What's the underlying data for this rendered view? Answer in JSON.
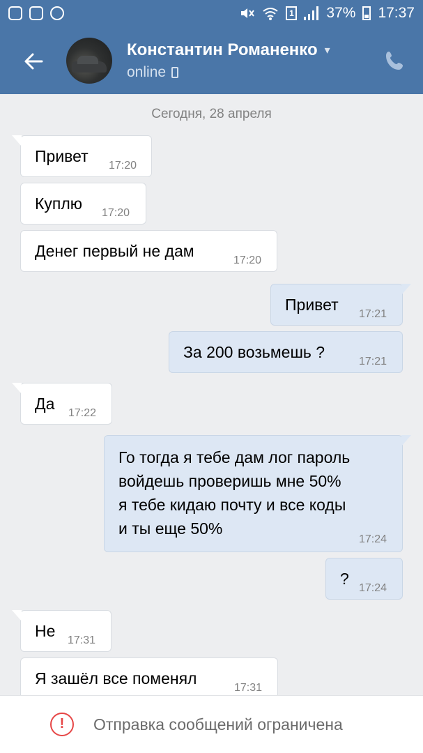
{
  "status_bar": {
    "battery": "37%",
    "time": "17:37",
    "sim": "1"
  },
  "header": {
    "contact_name": "Константин Романенко",
    "status": "online"
  },
  "chat": {
    "date_divider": "Сегодня, 28 апреля",
    "messages": [
      {
        "direction": "in",
        "text": "Привет",
        "time": "17:20"
      },
      {
        "direction": "in",
        "text": "Куплю",
        "time": "17:20"
      },
      {
        "direction": "in",
        "text": "Денег первый не дам",
        "time": "17:20"
      },
      {
        "direction": "out",
        "text": "Привет",
        "time": "17:21"
      },
      {
        "direction": "out",
        "text": "За 200 возьмешь ?",
        "time": "17:21"
      },
      {
        "direction": "in",
        "text": "Да",
        "time": "17:22"
      },
      {
        "direction": "out",
        "lines": [
          "Го тогда я тебе дам лог пароль",
          "войдешь проверишь мне 50%",
          "я тебе кидаю почту и все коды",
          "и ты еще 50%"
        ],
        "time": "17:24"
      },
      {
        "direction": "out",
        "text": "?",
        "time": "17:24"
      },
      {
        "direction": "in",
        "text": "Не",
        "time": "17:31"
      },
      {
        "direction": "in",
        "text": "Я зашёл все поменял",
        "time": "17:31"
      }
    ]
  },
  "footer": {
    "restriction_text": "Отправка сообщений ограничена",
    "warning_glyph": "!"
  },
  "colors": {
    "header_bg": "#4a76a8",
    "chat_bg": "#edeef0",
    "incoming_bubble": "#ffffff",
    "outgoing_bubble": "#dde7f4",
    "warning": "#e64646"
  },
  "icons": [
    "instagram-icon",
    "gallery-icon",
    "vk-icon",
    "mute-icon",
    "wifi-icon",
    "sim-icon",
    "signal-icon",
    "battery-icon",
    "back-arrow-icon",
    "chevron-down-icon",
    "mobile-device-icon",
    "phone-call-icon",
    "warning-icon"
  ]
}
